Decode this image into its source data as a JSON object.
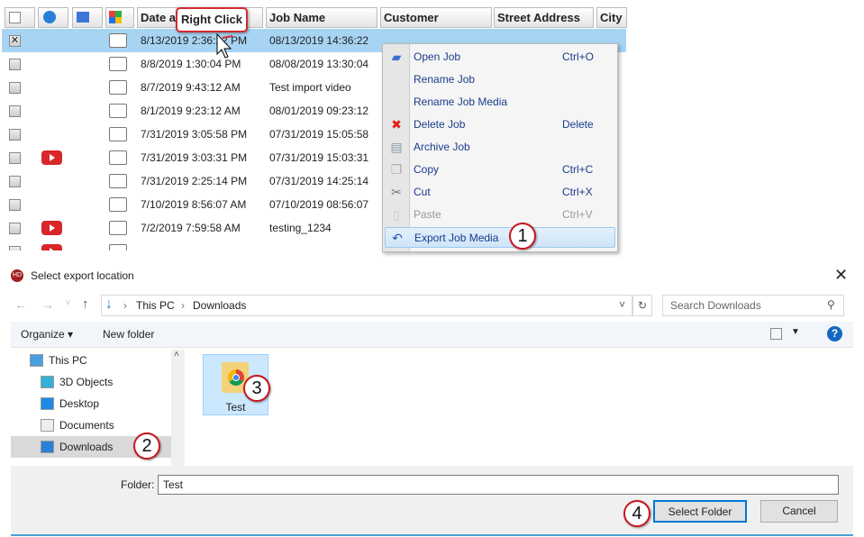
{
  "grid": {
    "columns": [
      "Date ar",
      "Job Name",
      "Customer",
      "Street Address",
      "City"
    ],
    "rows": [
      {
        "date": "8/13/2019 2:36:22 PM",
        "job": "08/13/2019 14:36:22",
        "checked": true,
        "video": false,
        "selected": true
      },
      {
        "date": "8/8/2019 1:30:04 PM",
        "job": "08/08/2019 13:30:04",
        "checked": false,
        "video": false
      },
      {
        "date": "8/7/2019 9:43:12 AM",
        "job": "Test import video",
        "checked": false,
        "video": false
      },
      {
        "date": "8/1/2019 9:23:12 AM",
        "job": "08/01/2019 09:23:12",
        "checked": false,
        "video": false
      },
      {
        "date": "7/31/2019 3:05:58 PM",
        "job": "07/31/2019 15:05:58",
        "checked": false,
        "video": false
      },
      {
        "date": "7/31/2019 3:03:31 PM",
        "job": "07/31/2019 15:03:31",
        "checked": false,
        "video": true
      },
      {
        "date": "7/31/2019 2:25:14 PM",
        "job": "07/31/2019 14:25:14",
        "checked": false,
        "video": false
      },
      {
        "date": "7/10/2019 8:56:07 AM",
        "job": "07/10/2019 08:56:07",
        "checked": false,
        "video": false
      },
      {
        "date": "7/2/2019 7:59:58 AM",
        "job": "testing_1234",
        "checked": false,
        "video": true
      }
    ]
  },
  "callout": "Right Click",
  "context_menu": [
    {
      "label": "Open Job",
      "shortcut": "Ctrl+O",
      "icon": "open-job-icon"
    },
    {
      "label": "Rename Job",
      "shortcut": ""
    },
    {
      "label": "Rename Job Media",
      "shortcut": ""
    },
    {
      "label": "Delete Job",
      "shortcut": "Delete",
      "icon": "delete-icon"
    },
    {
      "label": "Archive Job",
      "shortcut": "",
      "icon": "archive-icon"
    },
    {
      "label": "Copy",
      "shortcut": "Ctrl+C",
      "icon": "copy-icon"
    },
    {
      "label": "Cut",
      "shortcut": "Ctrl+X",
      "icon": "cut-icon"
    },
    {
      "label": "Paste",
      "shortcut": "Ctrl+V",
      "icon": "paste-icon",
      "disabled": true
    },
    {
      "label": "Export Job Media",
      "shortcut": "",
      "icon": "export-icon",
      "highlighted": true
    }
  ],
  "steps": [
    "1",
    "2",
    "3",
    "4"
  ],
  "dialog": {
    "title": "Select export location",
    "breadcrumb": [
      "This PC",
      "Downloads"
    ],
    "search_placeholder": "Search Downloads",
    "organize": "Organize",
    "new_folder": "New folder",
    "nav": [
      "This PC",
      "3D Objects",
      "Desktop",
      "Documents",
      "Downloads"
    ],
    "folder_item": "Test",
    "folder_label": "Folder:",
    "folder_value": "Test",
    "select_button": "Select Folder",
    "cancel_button": "Cancel"
  },
  "colors": {
    "selection": "#a8d4f4",
    "badge_border": "#c8161d",
    "accent": "#0078d7"
  }
}
